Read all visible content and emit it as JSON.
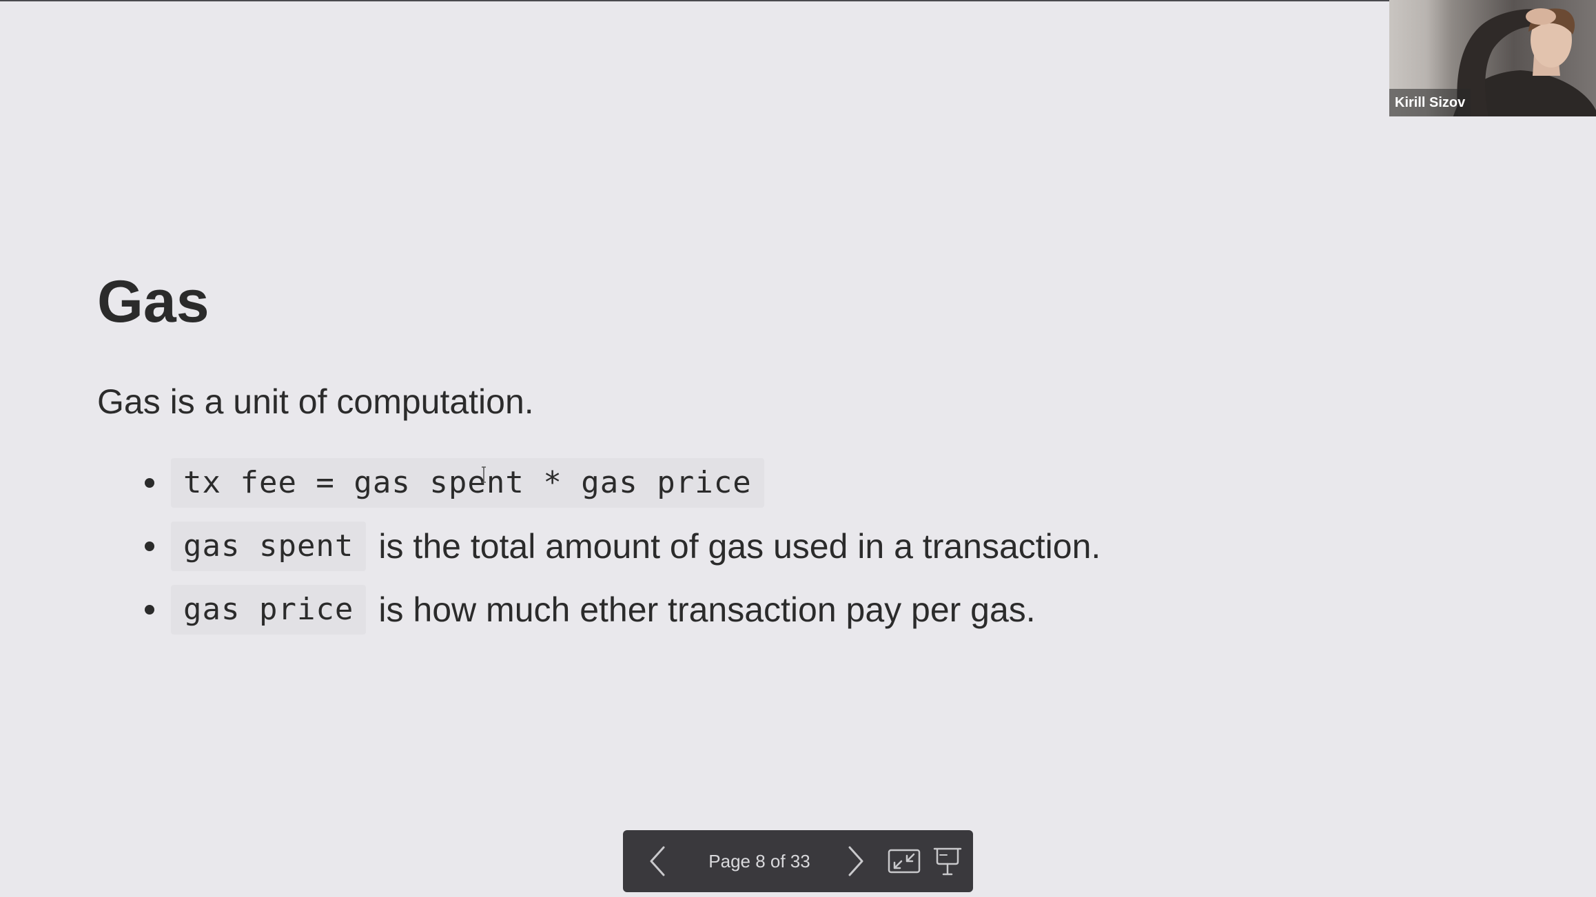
{
  "slide": {
    "title": "Gas",
    "subtitle": "Gas is a unit of computation.",
    "bullets": [
      {
        "code": "tx fee = gas spent * gas price",
        "text": ""
      },
      {
        "code": "gas spent",
        "text": "is the total amount of gas used in a transaction."
      },
      {
        "code": "gas price",
        "text": "is how much ether transaction pay per gas."
      }
    ]
  },
  "participant": {
    "name": "Kirill Sizov"
  },
  "controls": {
    "page_label": "Page 8 of 33",
    "prev_icon": "chevron-left-icon",
    "next_icon": "chevron-right-icon",
    "fit_icon": "exit-fullscreen-icon",
    "present_icon": "presentation-icon"
  },
  "colors": {
    "background": "#e9e8ec",
    "text": "#2b2b2b",
    "code_background": "#e2e1e5",
    "control_bar": "#3a393d",
    "control_icons": "#c9c9cc"
  }
}
